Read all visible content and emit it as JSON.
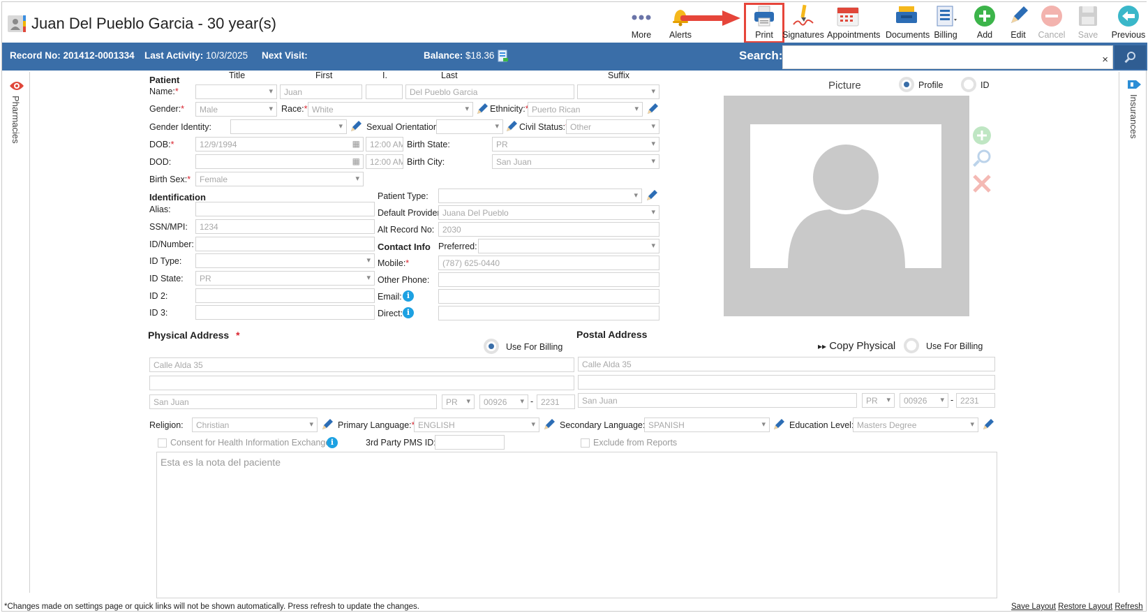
{
  "header": {
    "title": "Juan Del Pueblo Garcia - 30 year(s)",
    "toolbar": {
      "more": "More",
      "alerts": "Alerts",
      "print": "Print",
      "signatures": "Signatures",
      "appointments": "Appointments",
      "documents": "Documents",
      "billing": "Billing",
      "add": "Add",
      "edit": "Edit",
      "cancel": "Cancel",
      "save": "Save",
      "previous": "Previous"
    }
  },
  "infobar": {
    "record_label": "Record No:",
    "record_value": "201412-0001334",
    "activity_label": "Last Activity:",
    "activity_value": "10/3/2025",
    "next_visit_label": "Next Visit:",
    "balance_label": "Balance:",
    "balance_value": "$18.36",
    "search_label": "Search:",
    "search_clear": "×"
  },
  "side": {
    "left_tab": "Pharmacies",
    "right_tab": "Insurances"
  },
  "patient": {
    "section": "Patient",
    "col_title": "Title",
    "col_first": "First",
    "col_initial": "I.",
    "col_last": "Last",
    "col_suffix": "Suffix",
    "name_label": "Name:",
    "first": "Juan",
    "last": "Del Pueblo Garcia",
    "gender_label": "Gender:",
    "gender": "Male",
    "race_label": "Race:",
    "race": "White",
    "ethnicity_label": "Ethnicity:",
    "ethnicity": "Puerto Rican",
    "gender_identity_label": "Gender Identity:",
    "sexual_orientation_label": "Sexual Orientation:",
    "civil_status_label": "Civil Status:",
    "civil_status": "Other",
    "dob_label": "DOB:",
    "dob": "12/9/1994",
    "dob_time": "12:00 AM",
    "birth_state_label": "Birth State:",
    "birth_state": "PR",
    "dod_label": "DOD:",
    "dod_time": "12:00 AM",
    "birth_city_label": "Birth City:",
    "birth_city": "San Juan",
    "birth_sex_label": "Birth Sex:",
    "birth_sex": "Female"
  },
  "identification": {
    "section": "Identification",
    "alias_label": "Alias:",
    "ssn_label": "SSN/MPI:",
    "ssn": "1234",
    "idnumber_label": "ID/Number:",
    "idtype_label": "ID Type:",
    "idstate_label": "ID State:",
    "idstate": "PR",
    "id2_label": "ID 2:",
    "id3_label": "ID 3:",
    "patient_type_label": "Patient Type:",
    "default_provider_label": "Default Provider:",
    "default_provider": "Juana Del Pueblo",
    "alt_record_label": "Alt Record No:",
    "alt_record": "2030"
  },
  "contact": {
    "section": "Contact Info",
    "preferred_label": "Preferred:",
    "mobile_label": "Mobile:",
    "mobile": "(787) 625-0440",
    "other_phone_label": "Other Phone:",
    "email_label": "Email:",
    "direct_label": "Direct:",
    "info_glyph": "i"
  },
  "picture": {
    "label": "Picture",
    "profile": "Profile",
    "id": "ID"
  },
  "physical": {
    "section": "Physical Address",
    "use_billing": "Use For Billing",
    "line1": "Calle Alda 35",
    "line2": "",
    "city": "San Juan",
    "state": "PR",
    "zip": "00926",
    "zip_sep": "-",
    "zip4": "2231"
  },
  "postal": {
    "section": "Postal Address",
    "copy": "Copy Physical",
    "copy_glyph": "▸▸",
    "use_billing": "Use For Billing",
    "line1": "Calle Alda 35",
    "line2": "",
    "city": "San Juan",
    "state": "PR",
    "zip": "00926",
    "zip_sep": "-",
    "zip4": "2231"
  },
  "extra": {
    "religion_label": "Religion:",
    "religion": "Christian",
    "primary_lang_label": "Primary Language:",
    "primary_lang": "ENGLISH",
    "secondary_lang_label": "Secondary Language:",
    "secondary_lang": "SPANISH",
    "education_label": "Education Level:",
    "education": "Masters Degree",
    "consent_label": "Consent for Health Information Exchange",
    "pms_label": "3rd Party PMS ID:",
    "exclude_label": "Exclude from Reports",
    "notes": "Esta es la nota del paciente"
  },
  "footer": {
    "note": "*Changes made on settings page or quick links will not be shown automatically. Press refresh to update the changes.",
    "save_layout": "Save Layout",
    "restore_layout": "Restore Layout",
    "refresh": "Refresh"
  },
  "colors": {
    "bar": "#3a6ea8",
    "required": "#d9232e",
    "highlight": "#e6453a",
    "info": "#1da1e2"
  }
}
